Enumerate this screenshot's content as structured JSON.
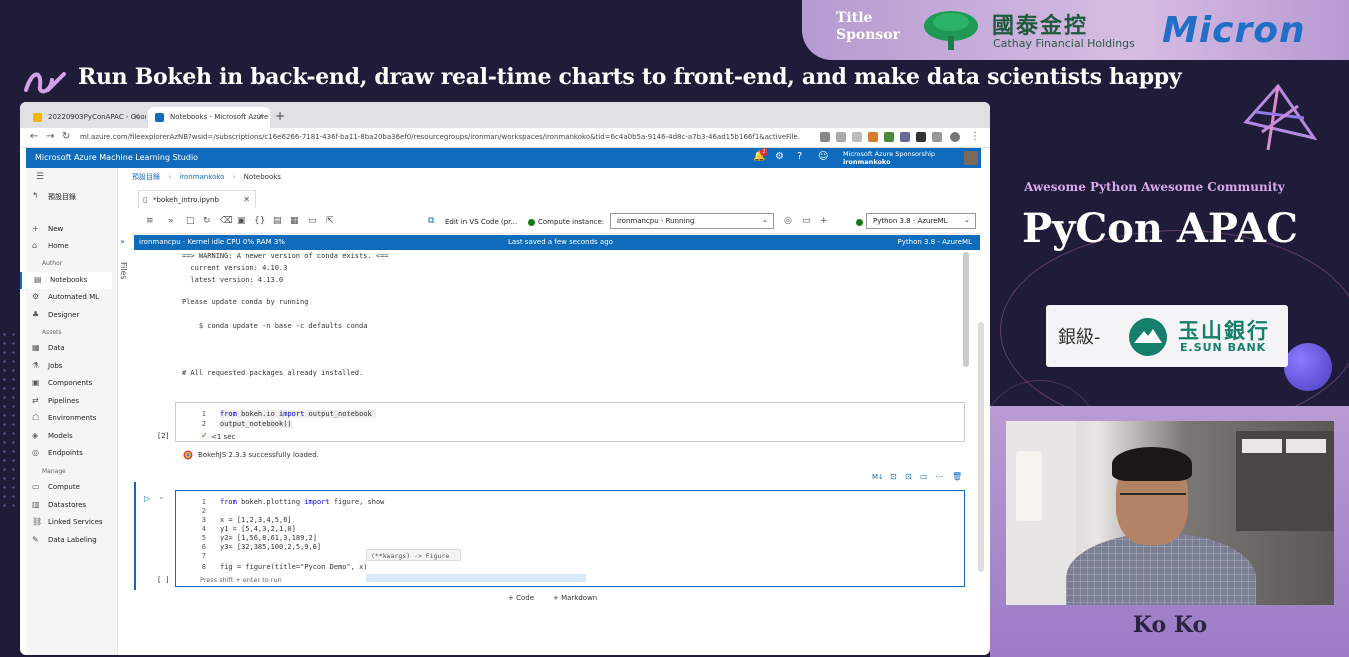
{
  "headline": "Run Bokeh in back-end, draw real-time charts to front-end, and make data scientists happy",
  "sponsor": {
    "label_line1": "Title",
    "label_line2": "Sponsor",
    "cathay_cn": "國泰金控",
    "cathay_en": "Cathay Financial Holdings",
    "micron": "Micron"
  },
  "event": {
    "tagline": "Awesome Python Awesome Community",
    "title": "PyCon APAC",
    "silver_label": "銀級-",
    "esun_cn": "玉山銀行",
    "esun_en": "E.SUN BANK",
    "speaker": "Ko Ko"
  },
  "browser": {
    "tabs": [
      {
        "label": "20220903PyConAPAC - Goog"
      },
      {
        "label": "Notebooks - Microsoft Azure M"
      }
    ],
    "url": "ml.azure.com/fileexplorerAzNB?wsid=/subscriptions/c16e6266-7181-436f-ba11-8ba20ba36ef0/resourcegroups/ironman/workspaces/ironmankoko&tid=6c4a0b5a-9146-4d8c-a7b3-46ad15b166f1&activeFile..."
  },
  "azure": {
    "title": "Microsoft Azure Machine Learning Studio",
    "badge": "2",
    "account_line1": "Microsoft Azure Sponsorship",
    "account_line2": "ironmankoko"
  },
  "sidebar": {
    "top_item": "預設目錄",
    "items_a": [
      {
        "label": "New",
        "icon": "+"
      },
      {
        "label": "Home",
        "icon": "⌂"
      }
    ],
    "section_author": "Author",
    "items_b": [
      {
        "label": "Notebooks",
        "icon": "▤"
      },
      {
        "label": "Automated ML",
        "icon": "⚙"
      },
      {
        "label": "Designer",
        "icon": "♣"
      }
    ],
    "section_assets": "Assets",
    "items_c": [
      {
        "label": "Data",
        "icon": "▦"
      },
      {
        "label": "Jobs",
        "icon": "⚗"
      },
      {
        "label": "Components",
        "icon": "▣"
      },
      {
        "label": "Pipelines",
        "icon": "⇄"
      },
      {
        "label": "Environments",
        "icon": "☖"
      },
      {
        "label": "Models",
        "icon": "◈"
      },
      {
        "label": "Endpoints",
        "icon": "◎"
      }
    ],
    "section_manage": "Manage",
    "items_d": [
      {
        "label": "Compute",
        "icon": "▭"
      },
      {
        "label": "Datastores",
        "icon": "▥"
      },
      {
        "label": "Linked Services",
        "icon": "⛓"
      },
      {
        "label": "Data Labeling",
        "icon": "✎"
      }
    ],
    "files_label": "Files"
  },
  "breadcrumb": {
    "root": "預設目錄",
    "user": "ironmankoko",
    "current": "Notebooks"
  },
  "notebook": {
    "tab_label": "*bokeh_intro.ipynb",
    "edit_vscode": "Edit in VS Code (pr...",
    "compute_label": "Compute instance:",
    "compute_value": "ironmancpu   -   Running",
    "kernel_value": "Python 3.8 - AzureML",
    "status_left": "ironmancpu · Kernel idle   CPU  0%   RAM  3%",
    "status_mid": "Last saved a few seconds ago",
    "status_right": "Python 3.8 - AzureML"
  },
  "output": {
    "line1": "==> WARNING: A newer version of conda exists. <==",
    "line2": "  current version: 4.10.3",
    "line3": "  latest version: 4.13.0",
    "line4": "Please update conda by running",
    "line5": "    $ conda update -n base -c defaults conda",
    "line6": "# All requested packages already installed."
  },
  "cell2": {
    "exec": "[2]",
    "ln1": "1",
    "ln2": "2",
    "kw_from": "from",
    "mod": "bokeh.io",
    "kw_import": "import",
    "name": "output_notebook",
    "code2": "output_notebook()",
    "timing": "<1 sec",
    "bokeh_loaded": "BokehJS 2.3.3 successfully loaded."
  },
  "cell3": {
    "exec": "[ ]",
    "lines": [
      {
        "n": "1",
        "code": ""
      },
      {
        "n": "2",
        "code": ""
      },
      {
        "n": "3",
        "code": "x = [1,2,3,4,5,6]"
      },
      {
        "n": "4",
        "code": "y1 = [5,4,3,2,1,0]"
      },
      {
        "n": "5",
        "code": "y2= [1,56,8,61,3,189,2]"
      },
      {
        "n": "6",
        "code": "y3= [32,385,100,2,5,9,6]"
      },
      {
        "n": "7",
        "code": ""
      },
      {
        "n": "8",
        "code": "fig = figure(title=\"Pycon Demo\", x)"
      }
    ],
    "line1_from": "from",
    "line1_mod": "bokeh.plotting",
    "line1_import": "import",
    "line1_names": "figure, show",
    "tooltip": "(**kwargs) -> Figure",
    "hint": "Press shift + enter to run",
    "add_code": "+ Code",
    "add_markdown": "+ Markdown"
  }
}
